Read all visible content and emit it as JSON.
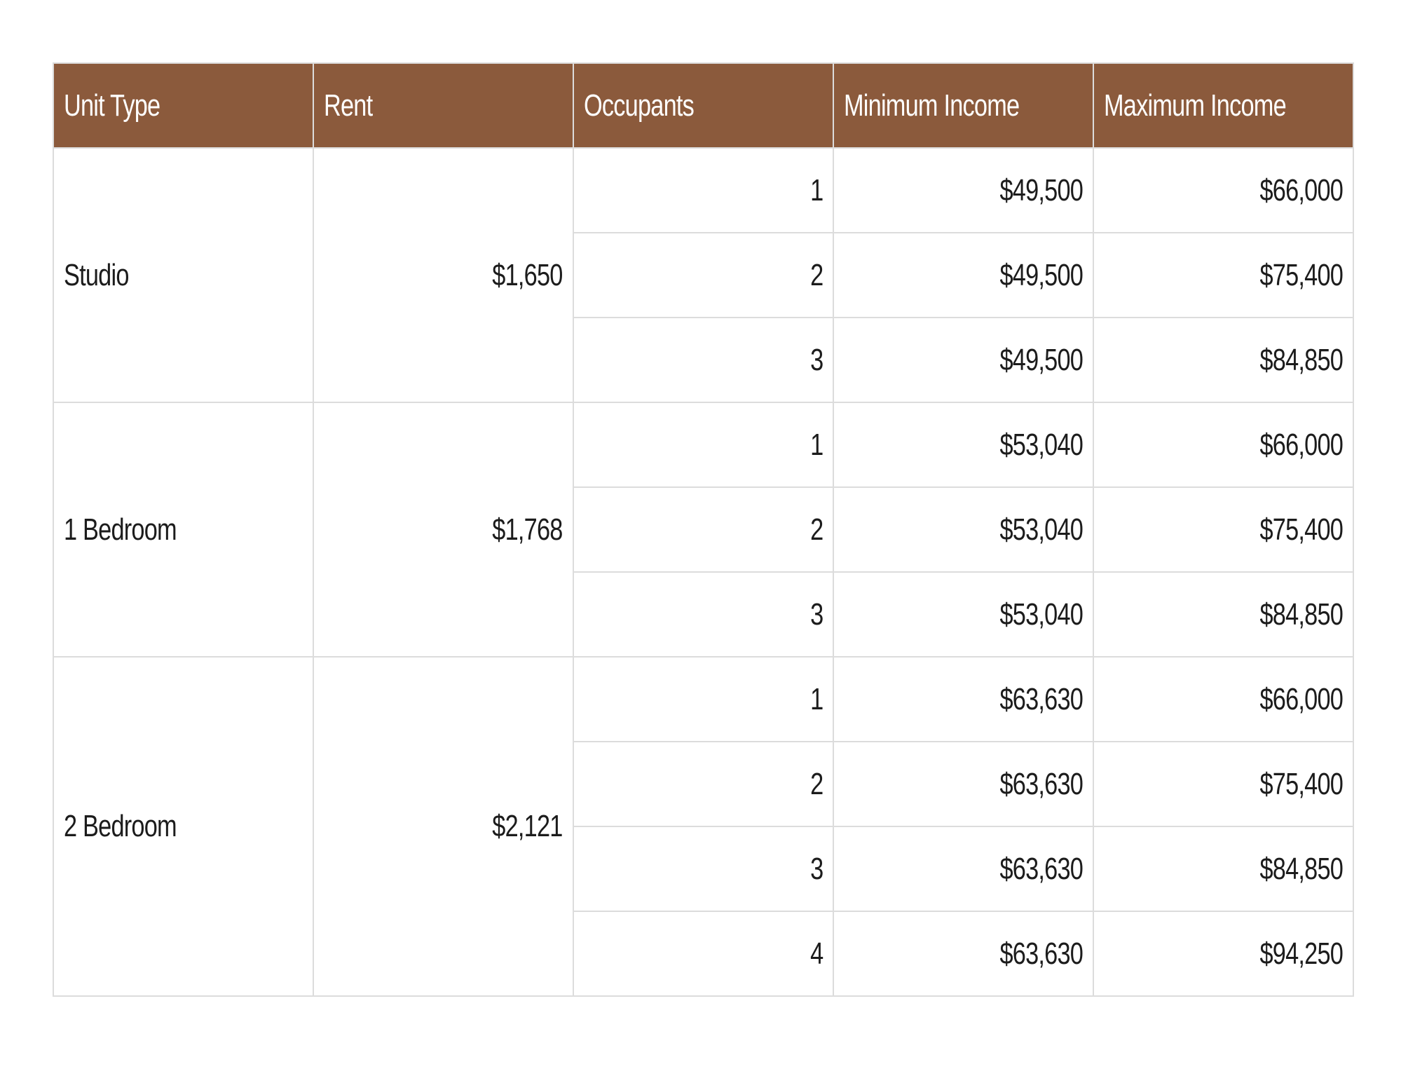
{
  "table": {
    "headers": [
      "Unit Type",
      "Rent",
      "Occupants",
      "Minimum Income",
      "Maximum Income"
    ],
    "groups": [
      {
        "unit_type": "Studio",
        "rent": "$1,650",
        "rows": [
          {
            "occupants": "1",
            "min_income": "$49,500",
            "max_income": "$66,000"
          },
          {
            "occupants": "2",
            "min_income": "$49,500",
            "max_income": "$75,400"
          },
          {
            "occupants": "3",
            "min_income": "$49,500",
            "max_income": "$84,850"
          }
        ]
      },
      {
        "unit_type": "1 Bedroom",
        "rent": "$1,768",
        "rows": [
          {
            "occupants": "1",
            "min_income": "$53,040",
            "max_income": "$66,000"
          },
          {
            "occupants": "2",
            "min_income": "$53,040",
            "max_income": "$75,400"
          },
          {
            "occupants": "3",
            "min_income": "$53,040",
            "max_income": "$84,850"
          }
        ]
      },
      {
        "unit_type": "2 Bedroom",
        "rent": "$2,121",
        "rows": [
          {
            "occupants": "1",
            "min_income": "$63,630",
            "max_income": "$66,000"
          },
          {
            "occupants": "2",
            "min_income": "$63,630",
            "max_income": "$75,400"
          },
          {
            "occupants": "3",
            "min_income": "$63,630",
            "max_income": "$84,850"
          },
          {
            "occupants": "4",
            "min_income": "$63,630",
            "max_income": "$94,250"
          }
        ]
      }
    ]
  },
  "colors": {
    "header_background": "#8b5a3c",
    "header_text": "#ffffff",
    "border": "#dcdcdc"
  }
}
